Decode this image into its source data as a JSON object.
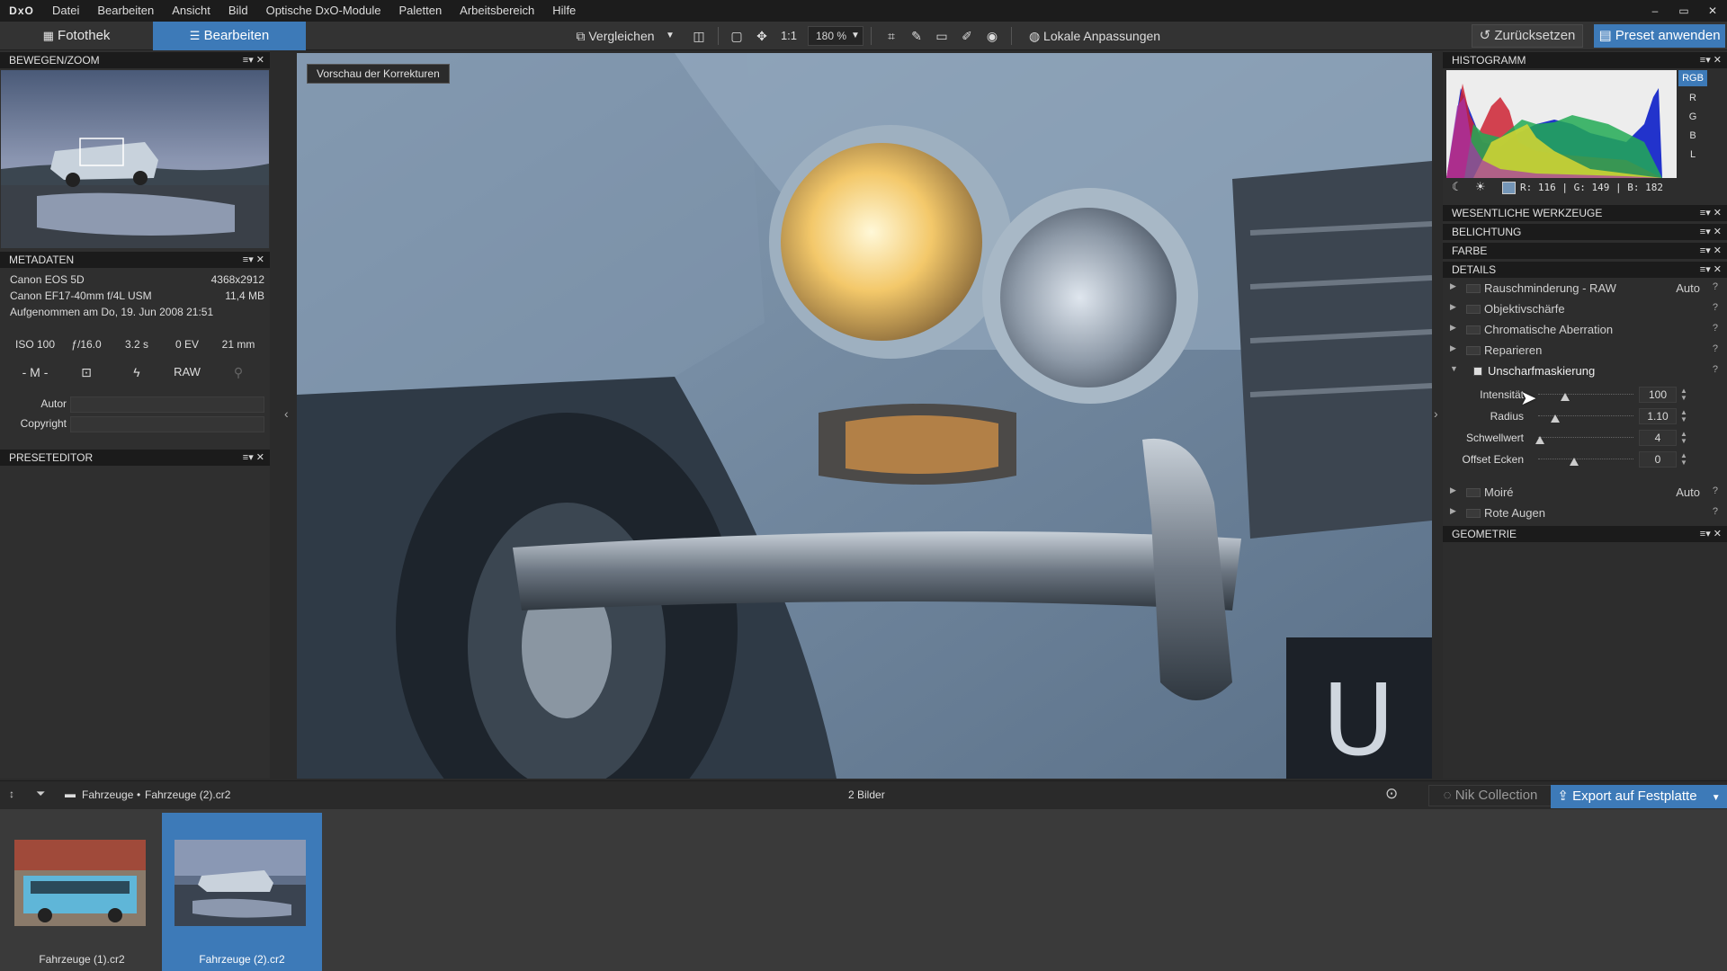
{
  "app": {
    "logo": "DxO"
  },
  "menu": [
    "Datei",
    "Bearbeiten",
    "Ansicht",
    "Bild",
    "Optische DxO-Module",
    "Paletten",
    "Arbeitsbereich",
    "Hilfe"
  ],
  "window_controls": [
    "–",
    "▭",
    "✕"
  ],
  "toolbar": {
    "tab_fotothek": "Fotothek",
    "tab_bearbeiten": "Bearbeiten",
    "compare_label": "Vergleichen",
    "one_to_one": "1:1",
    "zoom_value": "180 %",
    "local_adjust_label": "Lokale Anpassungen",
    "reset_label": "Zurücksetzen",
    "preset_label": "Preset anwenden"
  },
  "left": {
    "move_zoom_title": "BEWEGEN/ZOOM",
    "metadata_title": "METADATEN",
    "camera": "Canon EOS 5D",
    "resolution": "4368x2912",
    "lens": "Canon EF17-40mm f/4L USM",
    "filesize": "11,4 MB",
    "taken": "Aufgenommen am Do, 19. Jun 2008 21:51",
    "iso": "ISO 100",
    "aperture": "ƒ/16.0",
    "shutter": "3.2 s",
    "ev": "0 EV",
    "focal": "21 mm",
    "mode_m": "- M -",
    "raw": "RAW",
    "author_label": "Autor",
    "author_value": "",
    "copyright_label": "Copyright",
    "copyright_value": "",
    "preseteditor_title": "PRESETEDITOR"
  },
  "viewer": {
    "preview_label": "Vorschau der Korrekturen"
  },
  "right": {
    "histogram_title": "HISTOGRAMM",
    "channels": [
      "RGB",
      "R",
      "G",
      "B",
      "L"
    ],
    "readout": "R: 116 | G: 149 | B: 182",
    "sections": {
      "essential": "WESENTLICHE WERKZEUGE",
      "exposure": "BELICHTUNG",
      "color": "FARBE",
      "details": "DETAILS",
      "geometry": "GEOMETRIE"
    },
    "tools": {
      "noise": {
        "label": "Rauschminderung - RAW",
        "auto": "Auto"
      },
      "lens_sharp": {
        "label": "Objektivschärfe"
      },
      "chroma": {
        "label": "Chromatische Aberration"
      },
      "repair": {
        "label": "Reparieren"
      },
      "unsharp": {
        "label": "Unscharfmaskierung"
      },
      "moire": {
        "label": "Moiré",
        "auto": "Auto"
      },
      "red_eye": {
        "label": "Rote Augen"
      }
    },
    "help_mark": "?",
    "sliders": [
      {
        "label": "Intensität",
        "value": "100",
        "level": 0.28
      },
      {
        "label": "Radius",
        "value": "1.10",
        "level": 0.18
      },
      {
        "label": "Schwellwert",
        "value": "4",
        "level": 0.02
      },
      {
        "label": "Offset Ecken",
        "value": "0",
        "level": 0.38
      }
    ]
  },
  "filmstrip": {
    "path_folder": "Fahrzeuge",
    "path_file": "Fahrzeuge (2).cr2",
    "count": "2 Bilder",
    "nik_label": "Nik Collection",
    "export_label": "Export auf Festplatte",
    "thumbs": [
      "Fahrzeuge (1).cr2",
      "Fahrzeuge (2).cr2"
    ]
  },
  "colors": {
    "accent": "#3d7ab8",
    "panel": "#2d2d2d",
    "header": "#1b1b1b"
  }
}
